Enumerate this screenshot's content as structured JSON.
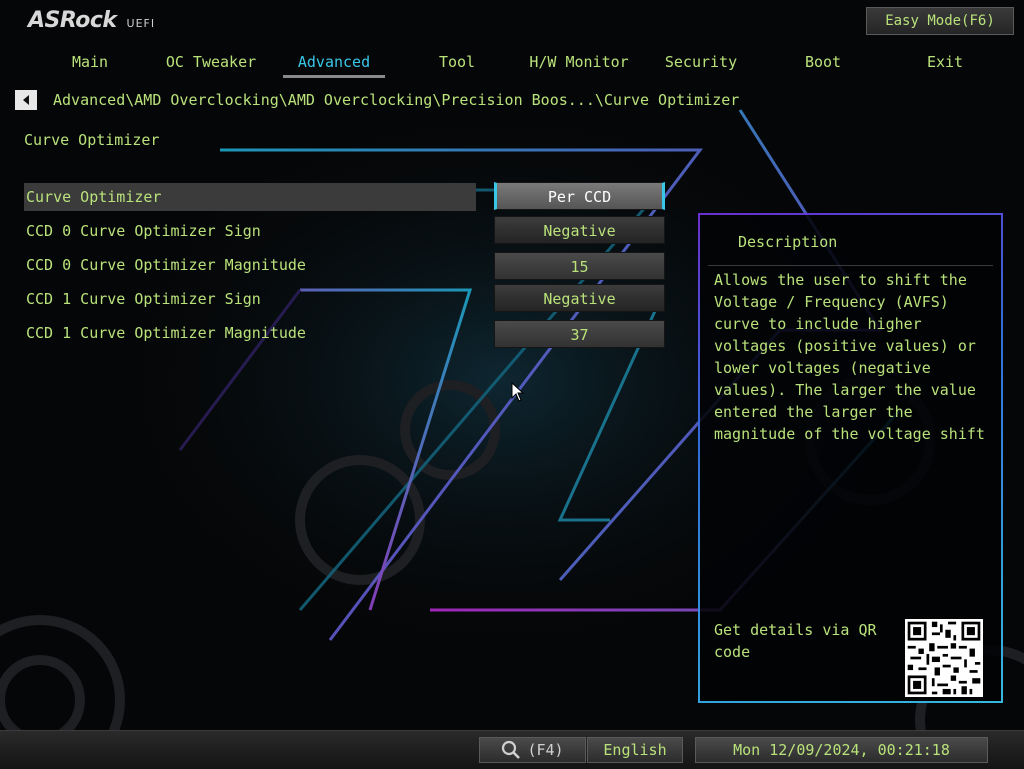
{
  "header": {
    "logo_brand": "ASRock",
    "logo_sub": "UEFI",
    "easy_mode_label": "Easy Mode(F6)"
  },
  "nav": {
    "tabs": [
      {
        "label": "Main"
      },
      {
        "label": "OC Tweaker"
      },
      {
        "label": "Advanced"
      },
      {
        "label": "Tool"
      },
      {
        "label": "H/W Monitor"
      },
      {
        "label": "Security"
      },
      {
        "label": "Boot"
      },
      {
        "label": "Exit"
      }
    ],
    "active_tab": "Advanced"
  },
  "breadcrumb": "Advanced\\AMD Overclocking\\AMD Overclocking\\Precision Boos...\\Curve Optimizer",
  "page_title": "Curve Optimizer",
  "settings": [
    {
      "label": "Curve Optimizer",
      "value": "Per CCD"
    },
    {
      "label": "CCD 0 Curve Optimizer Sign",
      "value": "Negative"
    },
    {
      "label": "CCD 0 Curve Optimizer Magnitude",
      "value": "15"
    },
    {
      "label": "CCD 1 Curve Optimizer Sign",
      "value": "Negative"
    },
    {
      "label": "CCD 1 Curve Optimizer Magnitude",
      "value": "37"
    }
  ],
  "description": {
    "title": "Description",
    "body": "Allows the user to shift the Voltage / Frequency (AVFS) curve to include higher voltages (positive values) or lower voltages (negative values). The larger the value entered the larger the magnitude of the voltage shift",
    "qr_text": "Get details via QR code"
  },
  "footer": {
    "search_key": "(F4)",
    "language": "English",
    "datetime": "Mon 12/09/2024, 00:21:18"
  },
  "colors": {
    "text": "#b9e27a",
    "accent": "#39c7e8",
    "background": "#050607"
  },
  "icons": [
    "back-arrow-icon",
    "search-icon",
    "mouse-cursor-icon",
    "qr-code"
  ]
}
